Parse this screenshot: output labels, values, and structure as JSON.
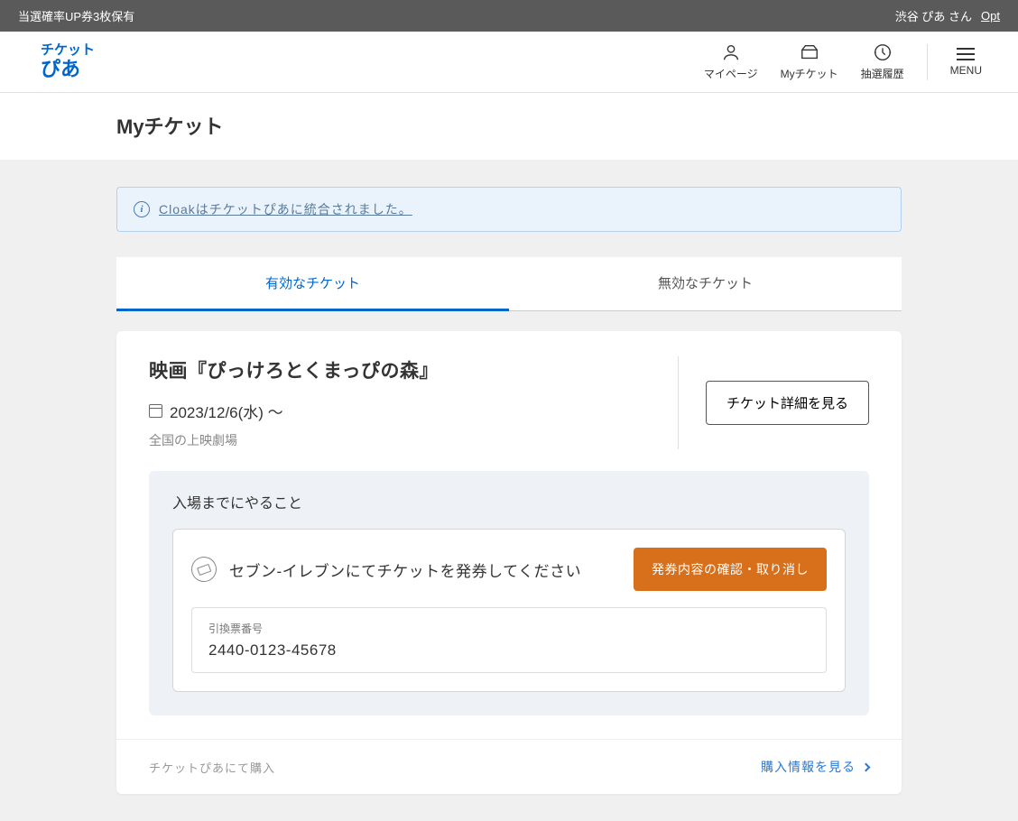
{
  "topbar": {
    "left": "当選確率UP券3枚保有",
    "user": "渋谷 ぴあ さん",
    "opt": "Opt"
  },
  "logo": {
    "line1": "チケット",
    "line2": "ぴあ"
  },
  "nav": {
    "mypage": "マイページ",
    "myticket": "Myチケット",
    "history": "抽選履歴",
    "menu": "MENU"
  },
  "page_title": "Myチケット",
  "banner": "Cloakはチケットぴあに統合されました。",
  "tabs": {
    "active": "有効なチケット",
    "inactive": "無効なチケット"
  },
  "ticket": {
    "title": "映画『ぴっけろとくまっぴの森』",
    "date": "2023/12/6(水) 〜",
    "venue": "全国の上映劇場",
    "detail_btn": "チケット詳細を見る"
  },
  "todo": {
    "heading": "入場までにやること",
    "instruction": "セブン-イレブンにてチケットを発券してください",
    "action_btn": "発券内容の確認・取り消し",
    "code_label": "引換票番号",
    "code_value": "2440-0123-45678"
  },
  "footer": {
    "source": "チケットぴあにて購入",
    "link": "購入情報を見る"
  }
}
